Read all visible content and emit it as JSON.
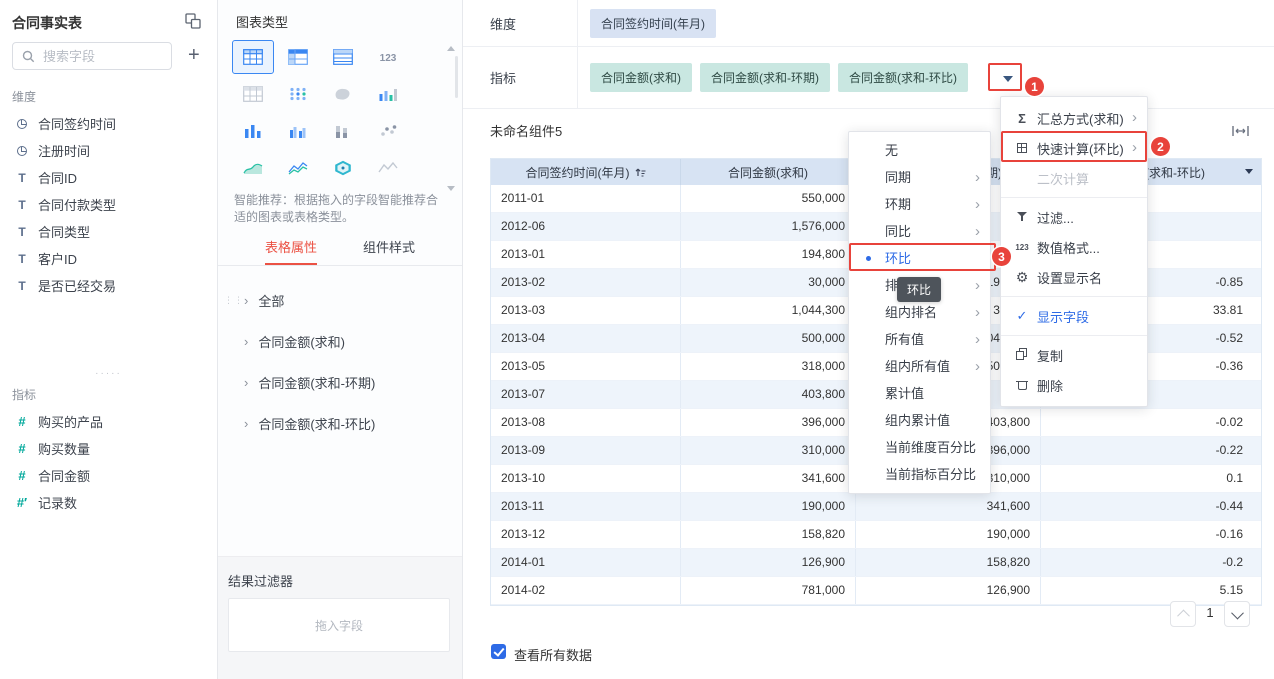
{
  "colors": {
    "annotation_red": "#e8433b",
    "primary_blue": "#2e6be6",
    "dimension_pill": "#d8e2f3",
    "measure_pill": "#c9e7e1",
    "table_header_bg": "#d7e3f3",
    "table_row_alt_bg": "#eef4fb",
    "active_tab_red": "#eb5244",
    "measure_icon_teal": "#00a89b"
  },
  "left_sidebar": {
    "title": "合同事实表",
    "search": {
      "placeholder": "搜索字段"
    },
    "dimensions_label": "维度",
    "dimension_fields": [
      {
        "icon": "clock",
        "label": "合同签约时间"
      },
      {
        "icon": "clock",
        "label": "注册时间"
      },
      {
        "icon": "text",
        "label": "合同ID"
      },
      {
        "icon": "text",
        "label": "合同付款类型"
      },
      {
        "icon": "text",
        "label": "合同类型"
      },
      {
        "icon": "text",
        "label": "客户ID"
      },
      {
        "icon": "text",
        "label": "是否已经交易"
      }
    ],
    "measures_label": "指标",
    "measure_fields": [
      {
        "icon": "num",
        "label": "购买的产品"
      },
      {
        "icon": "num",
        "label": "购买数量"
      },
      {
        "icon": "num",
        "label": "合同金额"
      },
      {
        "icon": "count",
        "label": "记录数"
      }
    ]
  },
  "chart_panel": {
    "title": "图表类型",
    "chart_type_icons": [
      "group-table",
      "cross-table",
      "detail-table",
      "kpi-card",
      "pivot-table",
      "point-chart",
      "filled-map",
      "multi-column",
      "column-chart",
      "column-duo",
      "stacked-chart",
      "scatter-chart",
      "area-chart",
      "line-chart",
      "gauge-chart",
      "spark-line"
    ],
    "selected_chart_type": "group-table",
    "hint": "智能推荐：根据拖入的字段智能推荐合适的图表或表格类型。",
    "tabs": [
      {
        "label": "表格属性",
        "active": true
      },
      {
        "label": "组件样式",
        "active": false
      }
    ],
    "property_groups": [
      {
        "label": "全部",
        "handle": true
      },
      {
        "label": "合同金额(求和)"
      },
      {
        "label": "合同金额(求和-环期)"
      },
      {
        "label": "合同金额(求和-环比)"
      }
    ],
    "result_filter": {
      "title": "结果过滤器",
      "dropzone_placeholder": "拖入字段"
    }
  },
  "shelves": {
    "dimension_label": "维度",
    "dimension_pills": [
      "合同签约时间(年月)"
    ],
    "measure_label": "指标",
    "measure_pills": [
      "合同金额(求和)",
      "合同金额(求和-环期)",
      "合同金额(求和-环比)"
    ]
  },
  "component": {
    "title": "未命名组件5",
    "view_all_label": "查看所有数据",
    "page_number": "1"
  },
  "chart_data": {
    "type": "table",
    "columns": [
      "合同签约时间(年月)",
      "合同金额(求和)",
      "合同金额(求和-环期)",
      "合同金额(求和-环比)"
    ],
    "rows": [
      [
        "2011-01",
        "550,000",
        "",
        ""
      ],
      [
        "2012-06",
        "1,576,000",
        "",
        ""
      ],
      [
        "2013-01",
        "194,800",
        "",
        ""
      ],
      [
        "2013-02",
        "30,000",
        "194,800",
        "-0.85"
      ],
      [
        "2013-03",
        "1,044,300",
        "30,000",
        "33.81"
      ],
      [
        "2013-04",
        "500,000",
        "1,044,300",
        "-0.52"
      ],
      [
        "2013-05",
        "318,000",
        "500,000",
        "-0.36"
      ],
      [
        "2013-07",
        "403,800",
        "",
        ""
      ],
      [
        "2013-08",
        "396,000",
        "403,800",
        "-0.02"
      ],
      [
        "2013-09",
        "310,000",
        "396,000",
        "-0.22"
      ],
      [
        "2013-10",
        "341,600",
        "310,000",
        "0.1"
      ],
      [
        "2013-11",
        "190,000",
        "341,600",
        "-0.44"
      ],
      [
        "2013-12",
        "158,820",
        "190,000",
        "-0.16"
      ],
      [
        "2014-01",
        "126,900",
        "158,820",
        "-0.2"
      ],
      [
        "2014-02",
        "781,000",
        "126,900",
        "5.15"
      ]
    ]
  },
  "quick_calc_menu": {
    "items": [
      {
        "label": "无"
      },
      {
        "label": "同期",
        "submenu": true
      },
      {
        "label": "环期",
        "submenu": true
      },
      {
        "label": "同比",
        "submenu": true
      },
      {
        "label": "环比",
        "selected": true
      },
      {
        "label": "排名",
        "submenu": true
      },
      {
        "label": "组内排名",
        "submenu": true
      },
      {
        "label": "所有值",
        "submenu": true
      },
      {
        "label": "组内所有值",
        "submenu": true
      },
      {
        "label": "累计值"
      },
      {
        "label": "组内累计值"
      },
      {
        "label": "当前维度百分比"
      },
      {
        "label": "当前指标百分比"
      }
    ]
  },
  "field_menu": {
    "items": [
      {
        "icon": "sum",
        "label": "汇总方式(求和)",
        "submenu": true
      },
      {
        "icon": "calc",
        "label": "快速计算(环比)",
        "submenu": true,
        "highlighted": true
      },
      {
        "icon": "",
        "label": "二次计算",
        "disabled": true,
        "divider_after": true
      },
      {
        "icon": "filter",
        "label": "过滤..."
      },
      {
        "icon": "numfmt",
        "label": "数值格式..."
      },
      {
        "icon": "gear",
        "label": "设置显示名",
        "divider_after": true
      },
      {
        "icon": "check",
        "label": "显示字段",
        "checked": true,
        "divider_after": true
      },
      {
        "icon": "copy",
        "label": "复制"
      },
      {
        "icon": "trash",
        "label": "删除"
      }
    ]
  },
  "tooltip_text": "环比",
  "annotations": {
    "badge1": "1",
    "badge2": "2",
    "badge3": "3"
  }
}
